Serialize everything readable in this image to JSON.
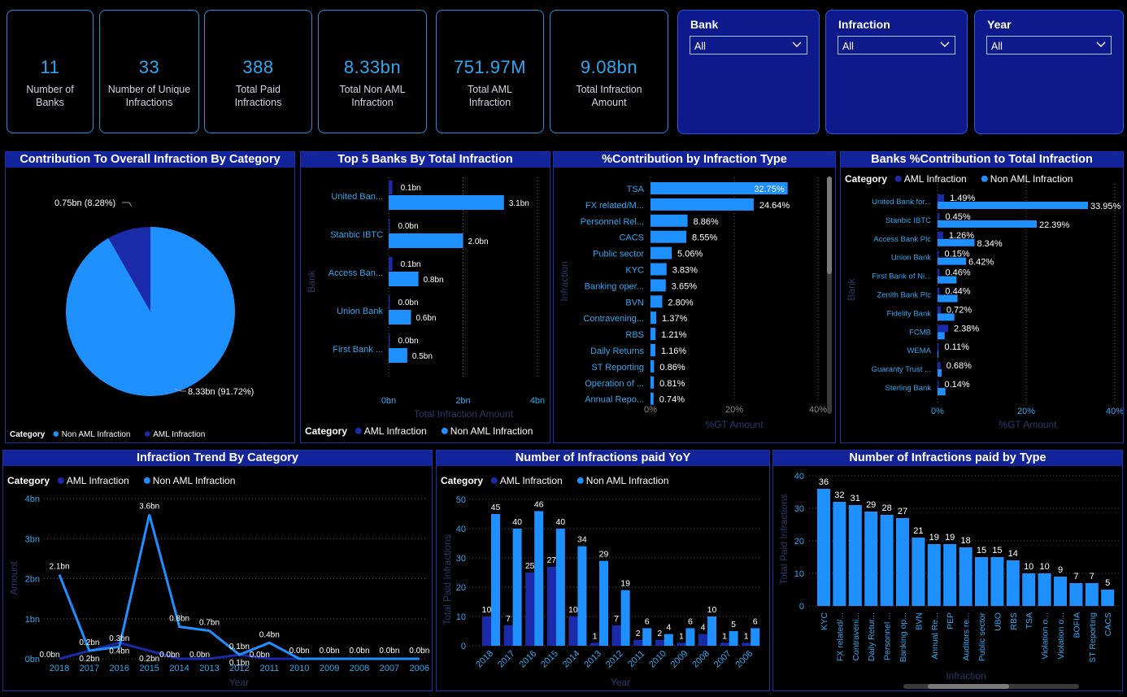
{
  "kpis": [
    {
      "value": "11",
      "label": "Number of Banks"
    },
    {
      "value": "33",
      "label": "Number of Unique Infractions"
    },
    {
      "value": "388",
      "label": "Total Paid Infractions"
    },
    {
      "value": "8.33bn",
      "label": "Total Non AML Infraction"
    },
    {
      "value": "751.97M",
      "label": "Total AML Infraction"
    },
    {
      "value": "9.08bn",
      "label": "Total Infraction Amount"
    }
  ],
  "slicers": [
    {
      "title": "Bank",
      "value": "All"
    },
    {
      "title": "Infraction",
      "value": "All"
    },
    {
      "title": "Year",
      "value": "All"
    }
  ],
  "colors": {
    "aml": "#1a2aa8",
    "non_aml": "#1e90ff",
    "title_bg": "#13239a",
    "axis_text": "#2fa8f0"
  },
  "charts": {
    "pie": {
      "title": "Contribution To Overall Infraction By Category",
      "legend_title": "Category",
      "legend": [
        "Non AML Infraction",
        "AML Infraction"
      ],
      "chart_data": {
        "type": "pie",
        "slices": [
          {
            "name": "Non AML Infraction",
            "value": 8.33,
            "label": "8.33bn (91.72%)"
          },
          {
            "name": "AML Infraction",
            "value": 0.75,
            "label": "0.75bn (8.28%)"
          }
        ]
      }
    },
    "top5": {
      "title": "Top 5 Banks By Total Infraction",
      "xlabel": "Total Infraction Amount",
      "ylabel": "Bank",
      "legend_title": "Category",
      "legend": [
        "AML Infraction",
        "Non AML Infraction"
      ],
      "ticks": [
        "0bn",
        "2bn",
        "4bn"
      ],
      "chart_data": {
        "type": "bar",
        "categories": [
          "United Ban...",
          "Stanbic IBTC",
          "Access Ban...",
          "Union Bank",
          "First Bank ..."
        ],
        "series": [
          {
            "name": "AML Infraction",
            "values": [
              0.1,
              0.0,
              0.1,
              0.0,
              0.0
            ],
            "labels": [
              "0.1bn",
              "0.0bn",
              "0.1bn",
              "0.0bn",
              "0.0bn"
            ]
          },
          {
            "name": "Non AML Infraction",
            "values": [
              3.1,
              2.0,
              0.8,
              0.6,
              0.5
            ],
            "labels": [
              "3.1bn",
              "2.0bn",
              "0.8bn",
              "0.6bn",
              "0.5bn"
            ]
          }
        ],
        "xlim": [
          0,
          4
        ]
      }
    },
    "types": {
      "title": "%Contribution by Infraction Type",
      "xlabel": "%GT Amount",
      "ylabel": "Infraction",
      "ticks": [
        "0%",
        "20%",
        "40%"
      ],
      "chart_data": {
        "type": "bar",
        "categories": [
          "TSA",
          "FX related/M...",
          "Personnel Rel...",
          "CACS",
          "Public sector",
          "KYC",
          "Banking oper...",
          "BVN",
          "Contravening...",
          "RBS",
          "Daily Returns",
          "ST Reporting",
          "Operation of ...",
          "Annual Repo..."
        ],
        "values": [
          32.75,
          24.64,
          8.86,
          8.55,
          5.06,
          3.83,
          3.65,
          2.8,
          1.37,
          1.21,
          1.16,
          0.86,
          0.81,
          0.74
        ],
        "labels": [
          "32.75%",
          "24.64%",
          "8.86%",
          "8.55%",
          "5.06%",
          "3.83%",
          "3.65%",
          "2.80%",
          "1.37%",
          "1.21%",
          "1.16%",
          "0.86%",
          "0.81%",
          "0.74%"
        ],
        "xlim": [
          0,
          40
        ]
      }
    },
    "banks_pct": {
      "title": "Banks %Contribution to Total Infraction",
      "xlabel": "%GT Amount",
      "ylabel": "Bank",
      "legend_title": "Category",
      "legend": [
        "AML Infraction",
        "Non AML Infraction"
      ],
      "ticks": [
        "0%",
        "20%",
        "40%"
      ],
      "chart_data": {
        "type": "bar",
        "categories": [
          "United Bank for...",
          "Stanbic IBTC",
          "Access Bank Plc",
          "Union Bank",
          "First Bank of Ni...",
          "Zenith Bank Plc",
          "Fidelity Bank",
          "FCMB",
          "WEMA",
          "Guaranty Trust ...",
          "Sterling Bank"
        ],
        "series": [
          {
            "name": "AML Infraction",
            "values": [
              1.49,
              0.45,
              1.26,
              0.15,
              0.46,
              0.44,
              0.72,
              2.38,
              0.11,
              0.68,
              0.14
            ],
            "labels": [
              "1.49%",
              "0.45%",
              "1.26%",
              "0.15%",
              "0.46%",
              "0.44%",
              "0.72%",
              "2.38%",
              "0.11%",
              "0.68%",
              "0.14%"
            ]
          },
          {
            "name": "Non AML Infraction",
            "values": [
              33.95,
              22.39,
              8.34,
              6.42,
              4.3,
              4.5,
              3.8,
              1.6,
              0.2,
              0.9,
              1.8
            ],
            "labels": [
              "33.95%",
              "22.39%",
              "8.34%",
              "6.42%",
              "",
              "",
              "",
              "",
              "",
              "",
              ""
            ]
          }
        ],
        "xlim": [
          0,
          40
        ]
      }
    },
    "trend": {
      "title": "Infraction Trend By Category",
      "xlabel": "Year",
      "ylabel": "Amount",
      "legend_title": "Category",
      "legend": [
        "AML Infraction",
        "Non AML Infraction"
      ],
      "yticks": [
        "0bn",
        "1bn",
        "2bn",
        "3bn",
        "4bn"
      ],
      "chart_data": {
        "type": "line",
        "x": [
          "2018",
          "2017",
          "2016",
          "2015",
          "2014",
          "2013",
          "2012",
          "2011",
          "2010",
          "2009",
          "2008",
          "2007",
          "2006"
        ],
        "series": [
          {
            "name": "Non AML Infraction",
            "values": [
              2.1,
              0.2,
              0.3,
              3.6,
              0.8,
              0.7,
              0.1,
              0.4,
              0.0,
              0.0,
              0.0,
              0.0,
              0.0
            ],
            "labels": [
              "2.1bn",
              "0.2bn",
              "0.3bn",
              "3.6bn",
              "0.8bn",
              "0.7bn",
              "0.1bn",
              "0.4bn",
              "0.0bn",
              "0.0bn",
              "0.0bn",
              "0.0bn",
              "0.0bn"
            ]
          },
          {
            "name": "AML Infraction",
            "values": [
              0.0,
              0.2,
              0.4,
              0.2,
              0.0,
              0.0,
              0.1,
              0.0,
              0.0,
              0.0,
              0.0,
              0.0,
              0.0
            ],
            "labels": [
              "0.0bn",
              "0.2bn",
              "0.4bn",
              "0.2bn",
              "0.0bn",
              "0.0bn",
              "0.1bn",
              "0.0bn",
              "",
              "",
              "",
              "",
              ""
            ]
          }
        ],
        "ylim": [
          0,
          4
        ]
      }
    },
    "yoy": {
      "title": "Number of Infractions paid YoY",
      "xlabel": "Year",
      "ylabel": "Total Paid Infractions",
      "legend_title": "Category",
      "legend": [
        "AML Infraction",
        "Non AML Infraction"
      ],
      "yticks": [
        "0",
        "10",
        "20",
        "30",
        "40",
        "50"
      ],
      "chart_data": {
        "type": "bar",
        "categories": [
          "2018",
          "2017",
          "2016",
          "2015",
          "2014",
          "2013",
          "2012",
          "2011",
          "2010",
          "2009",
          "2008",
          "2007",
          "2006"
        ],
        "series": [
          {
            "name": "AML Infraction",
            "values": [
              10,
              7,
              25,
              27,
              10,
              1,
              7,
              2,
              2,
              1,
              4,
              1,
              1
            ]
          },
          {
            "name": "Non AML Infraction",
            "values": [
              45,
              40,
              46,
              40,
              34,
              29,
              19,
              6,
              4,
              6,
              10,
              5,
              6
            ]
          }
        ],
        "ylim": [
          0,
          50
        ]
      }
    },
    "bytype": {
      "title": "Number of Infractions paid by Type",
      "xlabel": "Infraction",
      "ylabel": "Total Paid Infractions",
      "yticks": [
        "0",
        "10",
        "20",
        "30",
        "40"
      ],
      "chart_data": {
        "type": "bar",
        "categories": [
          "KYC",
          "FX related/...",
          "Contraveni...",
          "Daily Retur...",
          "Personnel ...",
          "Banking op...",
          "BVN",
          "Annual Re...",
          "PEP",
          "Auditors re...",
          "Public sector",
          "UBO",
          "RBS",
          "TSA",
          "Violation o...",
          "Violation o...",
          "BOFIA",
          "ST Reporting",
          "CACS"
        ],
        "values": [
          36,
          32,
          31,
          29,
          28,
          27,
          21,
          19,
          19,
          18,
          15,
          15,
          14,
          10,
          10,
          9,
          7,
          7,
          5
        ],
        "ylim": [
          0,
          40
        ]
      }
    }
  }
}
